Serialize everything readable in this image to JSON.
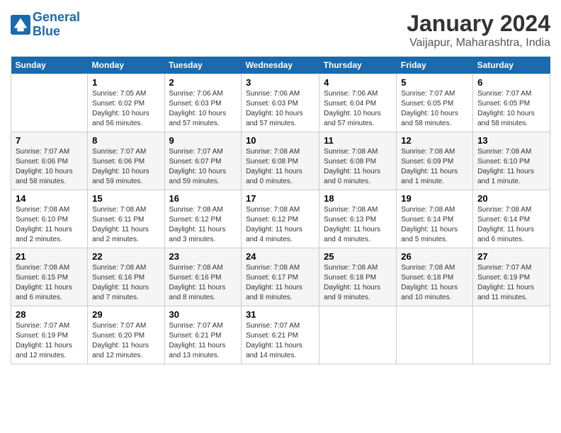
{
  "header": {
    "logo_line1": "General",
    "logo_line2": "Blue",
    "title": "January 2024",
    "subtitle": "Vaijapur, Maharashtra, India"
  },
  "weekdays": [
    "Sunday",
    "Monday",
    "Tuesday",
    "Wednesday",
    "Thursday",
    "Friday",
    "Saturday"
  ],
  "weeks": [
    [
      {
        "day": "",
        "info": ""
      },
      {
        "day": "1",
        "info": "Sunrise: 7:05 AM\nSunset: 6:02 PM\nDaylight: 10 hours\nand 56 minutes."
      },
      {
        "day": "2",
        "info": "Sunrise: 7:06 AM\nSunset: 6:03 PM\nDaylight: 10 hours\nand 57 minutes."
      },
      {
        "day": "3",
        "info": "Sunrise: 7:06 AM\nSunset: 6:03 PM\nDaylight: 10 hours\nand 57 minutes."
      },
      {
        "day": "4",
        "info": "Sunrise: 7:06 AM\nSunset: 6:04 PM\nDaylight: 10 hours\nand 57 minutes."
      },
      {
        "day": "5",
        "info": "Sunrise: 7:07 AM\nSunset: 6:05 PM\nDaylight: 10 hours\nand 58 minutes."
      },
      {
        "day": "6",
        "info": "Sunrise: 7:07 AM\nSunset: 6:05 PM\nDaylight: 10 hours\nand 58 minutes."
      }
    ],
    [
      {
        "day": "7",
        "info": "Sunrise: 7:07 AM\nSunset: 6:06 PM\nDaylight: 10 hours\nand 58 minutes."
      },
      {
        "day": "8",
        "info": "Sunrise: 7:07 AM\nSunset: 6:06 PM\nDaylight: 10 hours\nand 59 minutes."
      },
      {
        "day": "9",
        "info": "Sunrise: 7:07 AM\nSunset: 6:07 PM\nDaylight: 10 hours\nand 59 minutes."
      },
      {
        "day": "10",
        "info": "Sunrise: 7:08 AM\nSunset: 6:08 PM\nDaylight: 11 hours\nand 0 minutes."
      },
      {
        "day": "11",
        "info": "Sunrise: 7:08 AM\nSunset: 6:08 PM\nDaylight: 11 hours\nand 0 minutes."
      },
      {
        "day": "12",
        "info": "Sunrise: 7:08 AM\nSunset: 6:09 PM\nDaylight: 11 hours\nand 1 minute."
      },
      {
        "day": "13",
        "info": "Sunrise: 7:08 AM\nSunset: 6:10 PM\nDaylight: 11 hours\nand 1 minute."
      }
    ],
    [
      {
        "day": "14",
        "info": "Sunrise: 7:08 AM\nSunset: 6:10 PM\nDaylight: 11 hours\nand 2 minutes."
      },
      {
        "day": "15",
        "info": "Sunrise: 7:08 AM\nSunset: 6:11 PM\nDaylight: 11 hours\nand 2 minutes."
      },
      {
        "day": "16",
        "info": "Sunrise: 7:08 AM\nSunset: 6:12 PM\nDaylight: 11 hours\nand 3 minutes."
      },
      {
        "day": "17",
        "info": "Sunrise: 7:08 AM\nSunset: 6:12 PM\nDaylight: 11 hours\nand 4 minutes."
      },
      {
        "day": "18",
        "info": "Sunrise: 7:08 AM\nSunset: 6:13 PM\nDaylight: 11 hours\nand 4 minutes."
      },
      {
        "day": "19",
        "info": "Sunrise: 7:08 AM\nSunset: 6:14 PM\nDaylight: 11 hours\nand 5 minutes."
      },
      {
        "day": "20",
        "info": "Sunrise: 7:08 AM\nSunset: 6:14 PM\nDaylight: 11 hours\nand 6 minutes."
      }
    ],
    [
      {
        "day": "21",
        "info": "Sunrise: 7:08 AM\nSunset: 6:15 PM\nDaylight: 11 hours\nand 6 minutes."
      },
      {
        "day": "22",
        "info": "Sunrise: 7:08 AM\nSunset: 6:16 PM\nDaylight: 11 hours\nand 7 minutes."
      },
      {
        "day": "23",
        "info": "Sunrise: 7:08 AM\nSunset: 6:16 PM\nDaylight: 11 hours\nand 8 minutes."
      },
      {
        "day": "24",
        "info": "Sunrise: 7:08 AM\nSunset: 6:17 PM\nDaylight: 11 hours\nand 8 minutes."
      },
      {
        "day": "25",
        "info": "Sunrise: 7:08 AM\nSunset: 6:18 PM\nDaylight: 11 hours\nand 9 minutes."
      },
      {
        "day": "26",
        "info": "Sunrise: 7:08 AM\nSunset: 6:18 PM\nDaylight: 11 hours\nand 10 minutes."
      },
      {
        "day": "27",
        "info": "Sunrise: 7:07 AM\nSunset: 6:19 PM\nDaylight: 11 hours\nand 11 minutes."
      }
    ],
    [
      {
        "day": "28",
        "info": "Sunrise: 7:07 AM\nSunset: 6:19 PM\nDaylight: 11 hours\nand 12 minutes."
      },
      {
        "day": "29",
        "info": "Sunrise: 7:07 AM\nSunset: 6:20 PM\nDaylight: 11 hours\nand 12 minutes."
      },
      {
        "day": "30",
        "info": "Sunrise: 7:07 AM\nSunset: 6:21 PM\nDaylight: 11 hours\nand 13 minutes."
      },
      {
        "day": "31",
        "info": "Sunrise: 7:07 AM\nSunset: 6:21 PM\nDaylight: 11 hours\nand 14 minutes."
      },
      {
        "day": "",
        "info": ""
      },
      {
        "day": "",
        "info": ""
      },
      {
        "day": "",
        "info": ""
      }
    ]
  ]
}
